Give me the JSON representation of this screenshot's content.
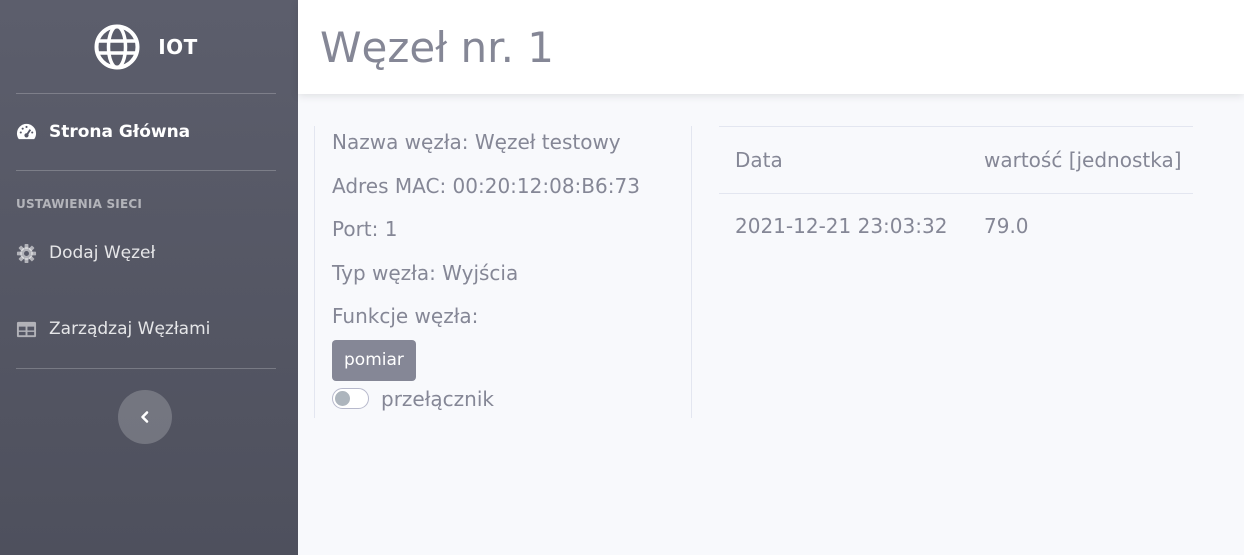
{
  "sidebar": {
    "brand": "IOT",
    "home": "Strona Główna",
    "section_heading": "USTAWIENIA SIECI",
    "add_node": "Dodaj Węzeł",
    "manage_nodes": "Zarządzaj Węzłami"
  },
  "page": {
    "title": "Węzeł nr. 1"
  },
  "node": {
    "name_line": "Nazwa węzła: Węzeł testowy",
    "mac_line": "Adres MAC: 00:20:12:08:B6:73",
    "port_line": "Port: 1",
    "type_line": "Typ węzła: Wyjścia",
    "functions_label": "Funkcje węzła:",
    "measure_button": "pomiar",
    "switch_label": "przełącznik",
    "switch_on": false
  },
  "readings": {
    "headers": [
      "Data",
      "wartość [jednostka]"
    ],
    "rows": [
      [
        "2021-12-21 23:03:32",
        "79.0"
      ]
    ]
  },
  "icons": {
    "brand": "globe-icon",
    "home": "tachometer-icon",
    "add_node": "gear-icon",
    "manage_nodes": "table-icon",
    "collapse": "chevron-left-icon"
  }
}
